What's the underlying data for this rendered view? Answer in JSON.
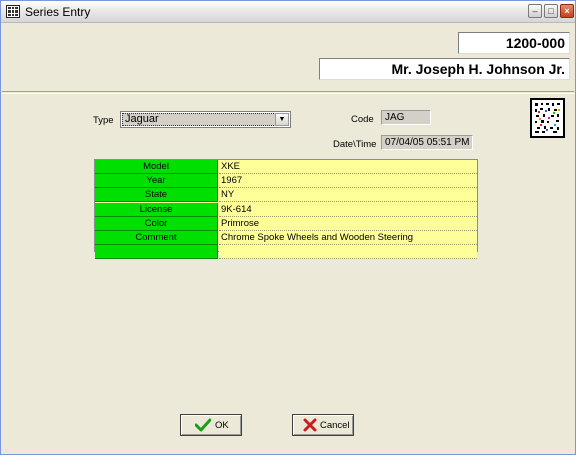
{
  "window": {
    "title": "Series Entry"
  },
  "header": {
    "series_number": "1200-000",
    "customer_name": "Mr. Joseph H. Johnson Jr."
  },
  "form": {
    "type_label": "Type",
    "type_value": "Jaguar",
    "code_label": "Code",
    "code_value": "JAG",
    "datetime_label": "Date\\Time",
    "datetime_value": "07/04/05 05:51 PM"
  },
  "details": [
    {
      "label": "Model",
      "value": "XKE"
    },
    {
      "label": "Year",
      "value": "1967"
    },
    {
      "label": "State",
      "value": "NY"
    },
    {
      "label": "License",
      "value": "9K-614"
    },
    {
      "label": "Color",
      "value": "Primrose"
    },
    {
      "label": "Comment",
      "value": "Chrome Spoke Wheels and Wooden Steering"
    },
    {
      "label": "",
      "value": ""
    }
  ],
  "buttons": {
    "ok_label": "OK",
    "cancel_label": "Cancel"
  },
  "colors": {
    "key_column": "#00e000",
    "value_column": "#ffff99",
    "ok_check": "#1a9e1a",
    "cancel_x": "#c81e1e"
  }
}
